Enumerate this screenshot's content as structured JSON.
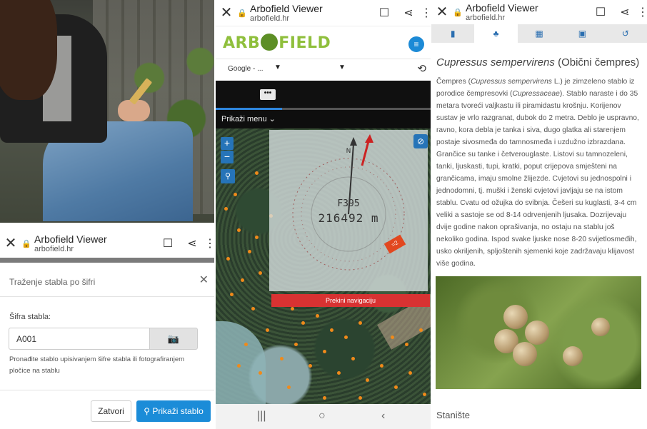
{
  "screen1": {
    "browser": {
      "title": "Arbofield Viewer",
      "url": "arbofield.hr"
    },
    "modal": {
      "title": "Traženje stabla po šifri",
      "field_label": "Šifra stabla:",
      "field_value": "A001",
      "help_text": "Pronađite stablo upisivanjem šifre stabla ili fotografiranjem pločice na stablu",
      "cancel_label": "Zatvori",
      "submit_label": "Prikaži stablo"
    }
  },
  "screen2": {
    "browser": {
      "title": "Arbofield Viewer",
      "url": "arbofield.hr"
    },
    "logo": {
      "left": "ARB",
      "right": "FIELD"
    },
    "layer_select": "Google - ...",
    "show_menu": "Prikaži menu",
    "nav": {
      "code": "F395",
      "distance": "216492 m",
      "stop_label": "Prekini navigaciju",
      "tag": "=2"
    },
    "colors": {
      "accent": "#1b8cd8",
      "stop": "#d83232",
      "tree_dot": "#f08a1a"
    }
  },
  "screen3": {
    "browser": {
      "title": "Arbofield Viewer",
      "url": "arbofield.hr"
    },
    "species_latin": "Cupressus sempervirens",
    "species_common": "(Obični čempres)",
    "description_parts": {
      "a": "Čempres (",
      "latin": "Cupressus sempervirens",
      "b": " L.) je zimzeleno stablo iz porodice čempresovki (",
      "family": "Cupressaceae",
      "c": "). Stablo naraste i do 35 metara tvoreći valjkastu ili piramidastu krošnju. Korijenov sustav je vrlo razgranat, dubok do 2 metra. Deblo je uspravno, ravno, kora debla je tanka i siva, dugo glatka ali starenjem postaje sivosmeđa do tamnosmeđa i uzdužno izbrazdana. Grančice su tanke i četverouglaste. Listovi su tamnozeleni, tanki, ljuskasti, tupi, kratki, poput crijepova smješteni na grančicama, imaju smolne žlijezde. Cvjetovi su jednospolni i jednodomni, tj. muški i ženski cvjetovi javljaju se na istom stablu. Cvatu od ožujka do svibnja. Češeri su kuglasti, 3-4 cm veliki a sastoje se od 8-14 odrvenjenih ljusaka. Dozrijevaju dvije godine nakon oprašivanja, no ostaju na stablu još nekoliko godina. Ispod svake ljuske nose 8-20 svijetlosmeđih, usko okriljenih, spljoštenih sjemenki koje zadržavaju klijavost više godina."
    },
    "section_heading": "Stanište"
  }
}
